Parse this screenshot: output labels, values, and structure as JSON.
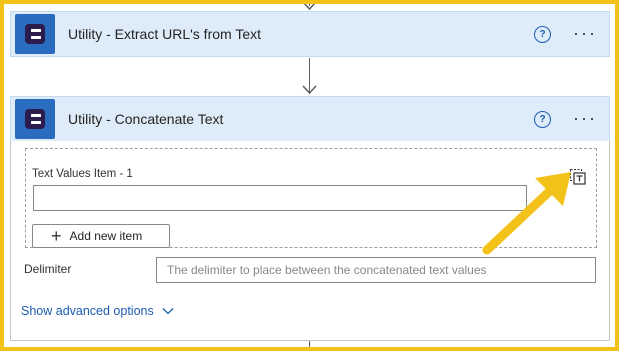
{
  "steps": [
    {
      "title": "Utility - Extract URL's from Text",
      "logo_icon": "utility-connector-logo",
      "help_icon": "question-circle-icon",
      "more_icon": "more-ellipsis-icon",
      "more_glyph": "···",
      "help_glyph": "?"
    },
    {
      "title": "Utility - Concatenate Text",
      "logo_icon": "utility-connector-logo",
      "help_icon": "question-circle-icon",
      "more_icon": "more-ellipsis-icon",
      "more_glyph": "···",
      "help_glyph": "?"
    }
  ],
  "concatenate_form": {
    "item_label": "Text Values Item - 1",
    "item_value": "",
    "switch_icon": "switch-to-text-mode-icon",
    "add_item_label": "Add new item",
    "add_item_icon": "plus-icon",
    "delimiter_label": "Delimiter",
    "delimiter_placeholder": "The delimiter to place between the concatenated text values",
    "advanced_label": "Show advanced options",
    "advanced_icon": "chevron-down-icon"
  },
  "colors": {
    "header_bg": "#deecf9",
    "logo_bg": "#2a6cbf",
    "accent_link": "#1c5bb0",
    "highlight_border": "#f2c218",
    "annotation_arrow": "#f2c218"
  }
}
